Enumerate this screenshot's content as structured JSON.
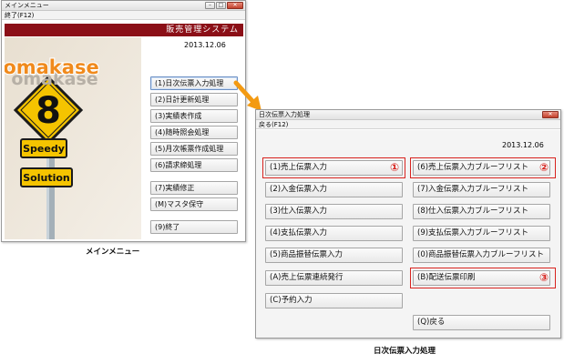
{
  "main_menu": {
    "window_title": "メインメニュー",
    "menu_label": "終了(F12)",
    "system_title": "販売管理システム",
    "date": "2013.12.06",
    "logo_text_top": "omakase",
    "logo_text_bottom": "omakase",
    "sign_number": "8",
    "sign_speedy": "Speedy",
    "sign_solution": "Solution",
    "buttons": [
      {
        "label": "(1)日次伝票入力処理"
      },
      {
        "label": "(2)日計更新処理"
      },
      {
        "label": "(3)実績表作成"
      },
      {
        "label": "(4)随時照会処理"
      },
      {
        "label": "(5)月次帳票作成処理"
      },
      {
        "label": "(6)請求締処理"
      },
      {
        "label": "(7)実績修正"
      },
      {
        "label": "(M)マスタ保守"
      },
      {
        "label": "(9)終了"
      }
    ],
    "caption": "メインメニュー"
  },
  "slip_window": {
    "window_title": "日次伝票入力処理",
    "menu_label": "戻る(F12)",
    "date": "2013.12.06",
    "left_buttons": [
      {
        "label": "(1)売上伝票入力"
      },
      {
        "label": "(2)入金伝票入力"
      },
      {
        "label": "(3)仕入伝票入力"
      },
      {
        "label": "(4)支払伝票入力"
      },
      {
        "label": "(5)商品振替伝票入力"
      },
      {
        "label": "(A)売上伝票連続発行"
      },
      {
        "label": "(C)予約入力"
      }
    ],
    "right_buttons": [
      {
        "label": "(6)売上伝票入力ブルーフリスト"
      },
      {
        "label": "(7)入金伝票入力ブルーフリスト"
      },
      {
        "label": "(8)仕入伝票入力ブルーフリスト"
      },
      {
        "label": "(9)支払伝票入力ブルーフリスト"
      },
      {
        "label": "(0)商品振替伝票入力ブルーフリスト"
      },
      {
        "label": "(B)配送伝票印刷"
      }
    ],
    "back_button": "(Q)戻る",
    "markers": [
      "①",
      "②",
      "③"
    ],
    "caption": "日次伝票入力処理"
  },
  "colors": {
    "title_bar_red": "#8b0f17",
    "highlight_red": "#d8231e",
    "arrow_orange": "#f39a12",
    "sign_yellow": "#f5c400",
    "logo_orange": "#f08a1c"
  }
}
